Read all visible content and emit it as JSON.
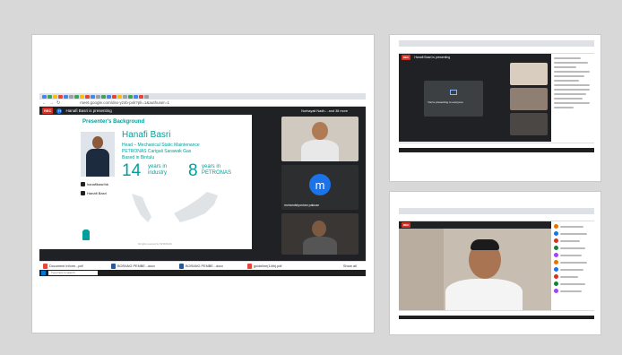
{
  "panel_main": {
    "url": "meet.google.com/dsx-yzxb-pxk?pli=1&authuser=1",
    "rec_label": "REC",
    "presenter_avatar": "H",
    "presenting_text": "Hanafi Basri is presenting",
    "viewer_text": "Nurhayati Nadh... and 38 more",
    "slide": {
      "heading": "Presenter's Background",
      "name": "Hanafi Basri",
      "line1": "Head – Mechanical Static Maintenance",
      "line2": "PETRONAS Carigali Sarawak Gas",
      "line3": "Based in Bintulu",
      "stat1_num": "14",
      "stat1_text": "years in industry",
      "stat2_num": "8",
      "stat2_text": "years in PETRONAS",
      "instagram": "hanafibasrihb",
      "facebook": "Hanafi Basri",
      "footer_note": "All rights reserved by PETRONAS"
    },
    "participant_avatar_letter": "m",
    "participant_name": "mohandstyoshan pakuan",
    "downloads": [
      {
        "name": "Document Inform...pdf"
      },
      {
        "name": "BORANG PEMBE...docx"
      },
      {
        "name": "BORANG PEMBE...docx"
      },
      {
        "name": "guideline(14th).pdf"
      }
    ],
    "show_all": "Show all",
    "search_placeholder": "Type here to search"
  },
  "panel_top_right": {
    "presenting_text": "Hanafi Basri is presenting",
    "center_text": "You're presenting to everyone"
  },
  "colors": {
    "petronas_teal": "#00a19c",
    "meet_dark": "#202124",
    "rec_red": "#d93025",
    "avatar_blue": "#1a73e8"
  }
}
